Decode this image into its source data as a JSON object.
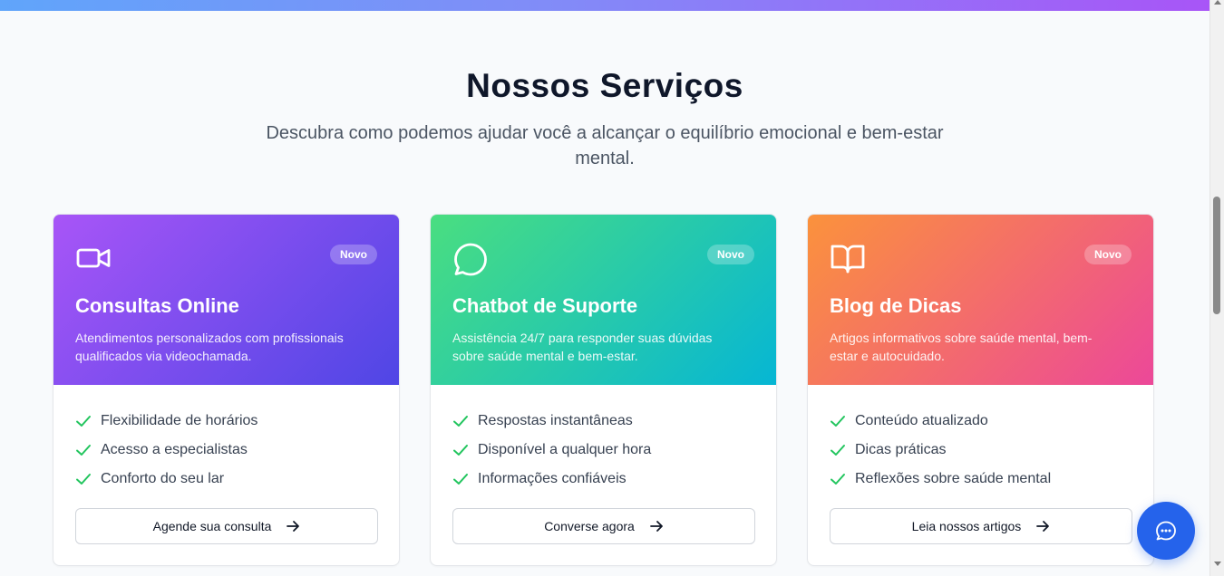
{
  "section": {
    "title": "Nossos Serviços",
    "subtitle": "Descubra como podemos ajudar você a alcançar o equilíbrio emocional e bem-estar mental."
  },
  "cards": [
    {
      "icon": "video-camera-icon",
      "badge": "Novo",
      "title": "Consultas Online",
      "description": "Atendimentos personalizados com profissionais qualificados via videochamada.",
      "features": [
        "Flexibilidade de horários",
        "Acesso a especialistas",
        "Conforto do seu lar"
      ],
      "cta": "Agende sua consulta",
      "gradient": [
        "#a855f7",
        "#4f46e5"
      ]
    },
    {
      "icon": "chat-bubble-icon",
      "badge": "Novo",
      "title": "Chatbot de Suporte",
      "description": "Assistência 24/7 para responder suas dúvidas sobre saúde mental e bem-estar.",
      "features": [
        "Respostas instantâneas",
        "Disponível a qualquer hora",
        "Informações confiáveis"
      ],
      "cta": "Converse agora",
      "gradient": [
        "#4ade80",
        "#06b6d4"
      ]
    },
    {
      "icon": "open-book-icon",
      "badge": "Novo",
      "title": "Blog de Dicas",
      "description": "Artigos informativos sobre saúde mental, bem-estar e autocuidado.",
      "features": [
        "Conteúdo atualizado",
        "Dicas práticas",
        "Reflexões sobre saúde mental"
      ],
      "cta": "Leia nossos artigos",
      "gradient": [
        "#fb923c",
        "#ec4899"
      ]
    }
  ],
  "colors": {
    "check": "#22c55e",
    "chat_button": "#2563eb"
  },
  "chat_button": {
    "icon": "chat-dots-icon"
  }
}
